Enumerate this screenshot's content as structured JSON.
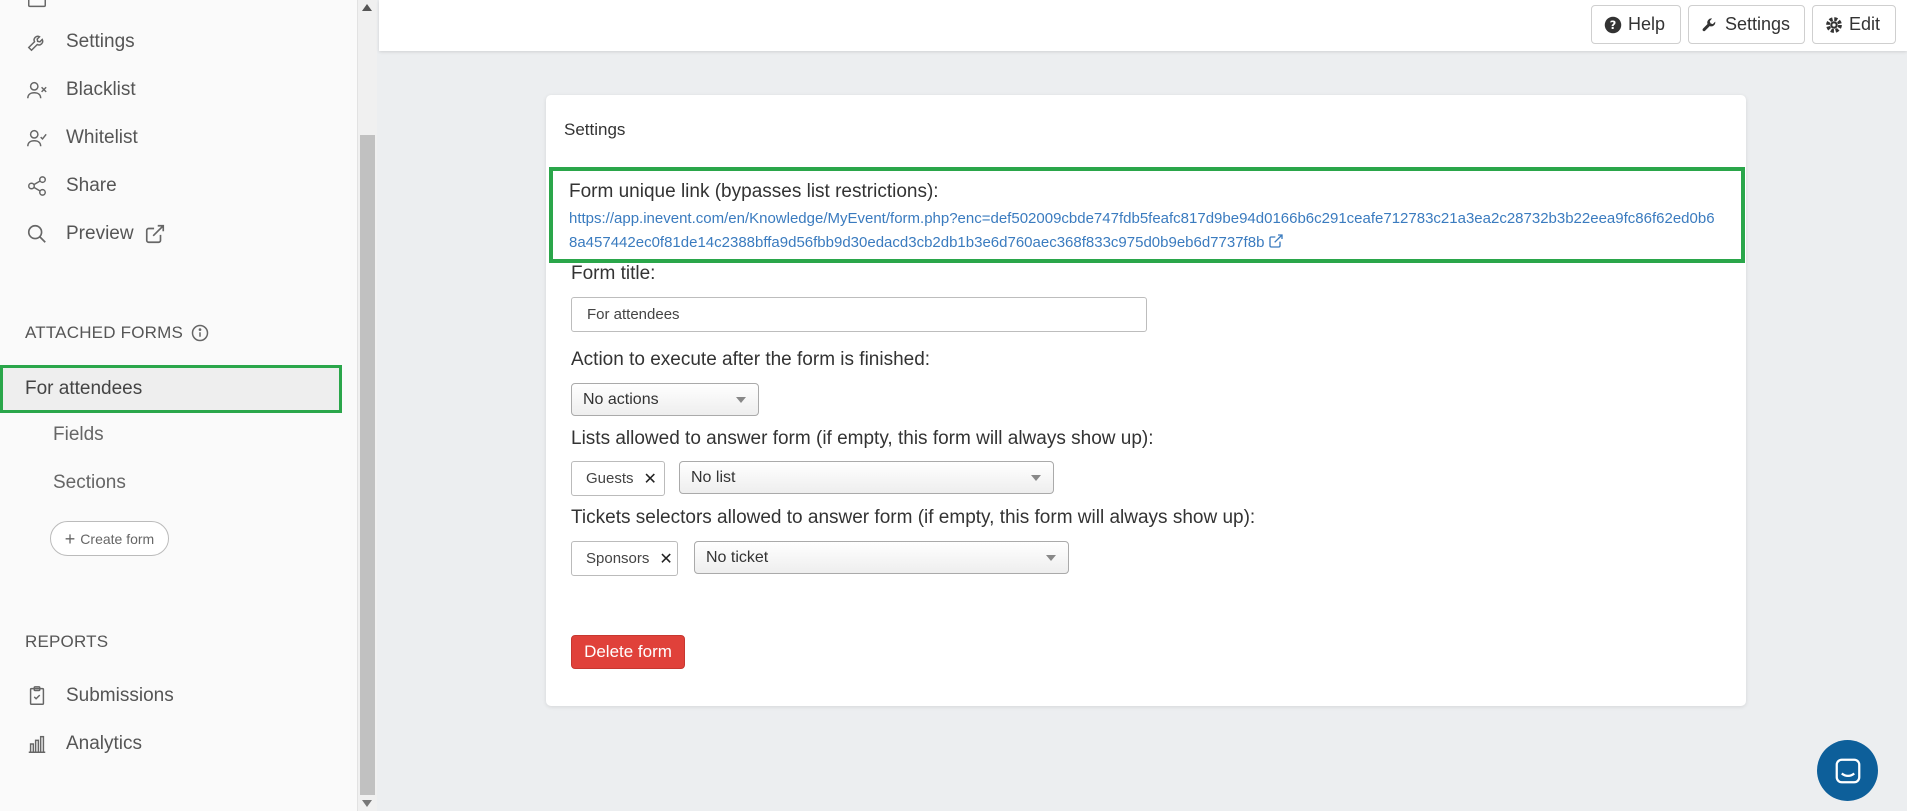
{
  "sidebar": {
    "items": [
      {
        "label": "Settings",
        "icon": "wrench-icon"
      },
      {
        "label": "Blacklist",
        "icon": "user-x-icon"
      },
      {
        "label": "Whitelist",
        "icon": "user-check-icon"
      },
      {
        "label": "Share",
        "icon": "share-icon"
      },
      {
        "label": "Preview",
        "icon": "search-icon"
      }
    ],
    "attached_forms_title": "ATTACHED FORMS",
    "selected_form": "For attendees",
    "sub_items": [
      "Fields",
      "Sections"
    ],
    "create_form_label": "Create form",
    "reports_title": "REPORTS",
    "report_items": [
      {
        "label": "Submissions",
        "icon": "clipboard-check-icon"
      },
      {
        "label": "Analytics",
        "icon": "bar-chart-icon"
      }
    ]
  },
  "topbar": {
    "help_label": "Help",
    "settings_label": "Settings",
    "edit_label": "Edit"
  },
  "card": {
    "title": "Settings",
    "unique_link_label": "Form unique link (bypasses list restrictions):",
    "unique_link_url": "https://app.inevent.com/en/Knowledge/MyEvent/form.php?enc=def502009cbde747fdb5feafc817d9be94d0166b6c291ceafe712783c21a3ea2c28732b3b22eea9fc86f62ed0b68a457442ec0f81de14c2388bffa9d56fbb9d30edacd3cb2db1b3e6d760aec368f833c975d0b9eb6d7737f8b",
    "form_title_label": "Form title:",
    "form_title_value": "For attendees",
    "action_label": "Action to execute after the form is finished:",
    "action_value": "No actions",
    "lists_label": "Lists allowed to answer form (if empty, this form will always show up):",
    "lists_tag": "Guests",
    "lists_select_value": "No list",
    "tickets_label": "Tickets selectors allowed to answer form (if empty, this form will always show up):",
    "tickets_tag": "Sponsors",
    "tickets_select_value": "No ticket",
    "delete_label": "Delete form"
  },
  "colors": {
    "highlight": "#2aa64a",
    "link": "#3a7bbf",
    "danger": "#e0413a",
    "chat": "#0d5f9a"
  }
}
